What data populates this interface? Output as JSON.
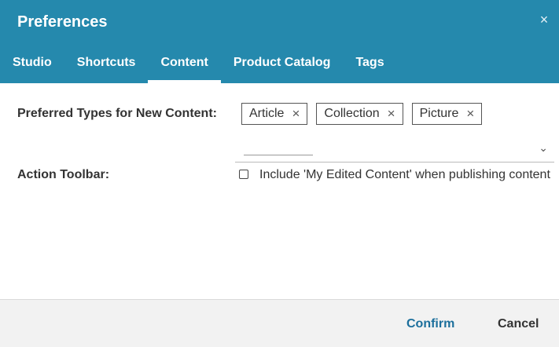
{
  "dialog": {
    "title": "Preferences",
    "close_glyph": "×"
  },
  "tabs": [
    {
      "label": "Studio",
      "active": false
    },
    {
      "label": "Shortcuts",
      "active": false
    },
    {
      "label": "Content",
      "active": true
    },
    {
      "label": "Product Catalog",
      "active": false
    },
    {
      "label": "Tags",
      "active": false
    }
  ],
  "content": {
    "preferred_types": {
      "label": "Preferred Types for New Content:",
      "chips": [
        "Article",
        "Collection",
        "Picture"
      ],
      "remove_glyph": "×",
      "dropdown_glyph": "⌄"
    },
    "action_toolbar": {
      "label": "Action Toolbar:",
      "checkbox_label": "Include 'My Edited Content' when publishing content",
      "checked": false
    }
  },
  "footer": {
    "confirm_label": "Confirm",
    "cancel_label": "Cancel"
  },
  "colors": {
    "header_bg": "#2589ad",
    "confirm_text": "#1c6f9c",
    "footer_bg": "#f2f2f2"
  }
}
